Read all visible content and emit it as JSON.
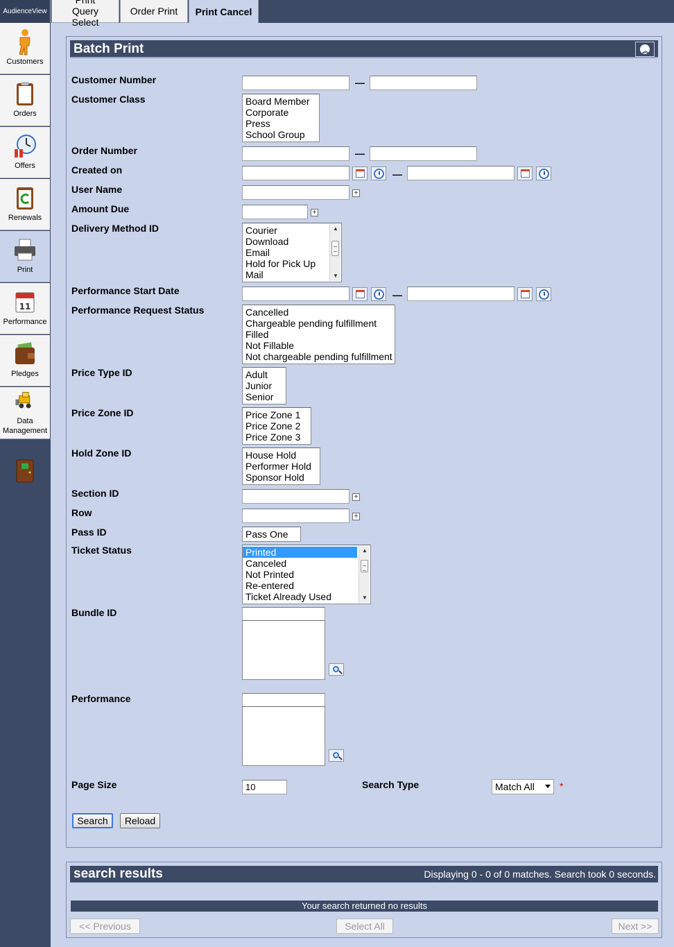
{
  "app": {
    "name": "AudienceView"
  },
  "tabs": [
    {
      "label": "Print Query Select"
    },
    {
      "label": "Order Print"
    },
    {
      "label": "Print Cancel"
    }
  ],
  "sidebar": {
    "items": [
      {
        "label": "Customers",
        "icon": "customer-icon"
      },
      {
        "label": "Orders",
        "icon": "clipboard-icon"
      },
      {
        "label": "Offers",
        "icon": "clock-gift-icon"
      },
      {
        "label": "Renewals",
        "icon": "renewal-icon"
      },
      {
        "label": "Print",
        "icon": "printer-icon"
      },
      {
        "label": "Performance",
        "icon": "calendar-icon"
      },
      {
        "label": "Pledges",
        "icon": "wallet-icon"
      },
      {
        "label": "Data Management",
        "icon": "bulldozer-icon"
      }
    ],
    "calendar_day": "11"
  },
  "batch_print": {
    "title": "Batch Print",
    "labels": {
      "customer_number": "Customer Number",
      "customer_class": "Customer Class",
      "order_number": "Order Number",
      "created_on": "Created on",
      "user_name": "User Name",
      "amount_due": "Amount Due",
      "delivery_method": "Delivery Method ID",
      "performance_start": "Performance Start Date",
      "performance_request_status": "Performance Request Status",
      "price_type": "Price Type ID",
      "price_zone": "Price Zone ID",
      "hold_zone": "Hold Zone ID",
      "section": "Section ID",
      "row": "Row",
      "pass": "Pass ID",
      "ticket_status": "Ticket Status",
      "bundle": "Bundle ID",
      "performance": "Performance",
      "page_size": "Page Size",
      "search_type": "Search Type"
    },
    "range_separator": "—",
    "customer_class_options": [
      "Board Member",
      "Corporate",
      "Press",
      "School Group"
    ],
    "delivery_method_options": [
      "Courier",
      "Download",
      "Email",
      "Hold for Pick Up",
      "Mail"
    ],
    "performance_request_status_options": [
      "Cancelled",
      "Chargeable pending fulfillment",
      "Filled",
      "Not Fillable",
      "Not chargeable pending fulfillment"
    ],
    "price_type_options": [
      "Adult",
      "Junior",
      "Senior"
    ],
    "price_zone_options": [
      "Price Zone 1",
      "Price Zone 2",
      "Price Zone 3"
    ],
    "hold_zone_options": [
      "House Hold",
      "Performer Hold",
      "Sponsor Hold"
    ],
    "pass_options": [
      "Pass One"
    ],
    "ticket_status_options": [
      "Printed",
      "Canceled",
      "Not Printed",
      "Re-entered",
      "Ticket Already Used"
    ],
    "ticket_status_selected": "Printed",
    "page_size_value": "10",
    "search_type_value": "Match All",
    "required_marker": "*",
    "search_button": "Search",
    "reload_button": "Reload"
  },
  "search_results": {
    "title": "search results",
    "summary": "Displaying 0 - 0 of 0 matches. Search took 0 seconds.",
    "empty_message": "Your search returned no results",
    "prev_button": "<< Previous",
    "select_all_button": "Select All",
    "next_button": "Next >>"
  },
  "colors": {
    "chrome": "#3d4a66",
    "background": "#c9d4eb",
    "selection": "#3399ff"
  }
}
